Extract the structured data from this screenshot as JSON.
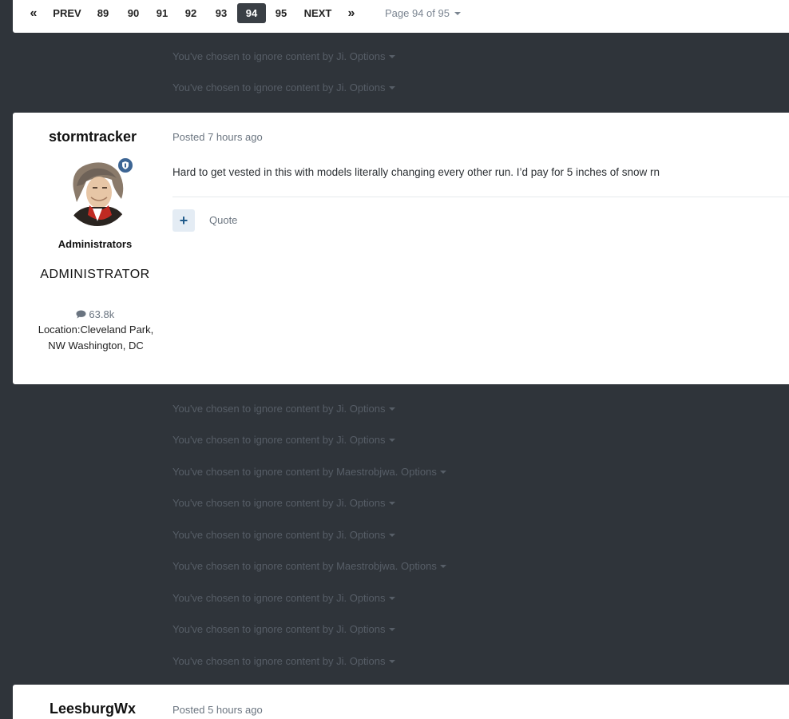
{
  "pagination": {
    "first": "«",
    "prev": "PREV",
    "pages": [
      "89",
      "90",
      "91",
      "92",
      "93",
      "94",
      "95"
    ],
    "active": "94",
    "next": "NEXT",
    "last": "»",
    "page_of": "Page 94 of 95"
  },
  "ignored_top": [
    "You've chosen to ignore content by Ji. Options",
    "You've chosen to ignore content by Ji. Options"
  ],
  "post1": {
    "author": "stormtracker",
    "group": "Administrators",
    "rank": "ADMINISTRATOR",
    "post_count": "63.8k",
    "location_label": "Location:",
    "location_value": "Cleveland Park, NW Washington, DC",
    "posted": "Posted 7 hours ago",
    "content": "Hard to get vested in this with models literally changing every other run. I’d pay for 5 inches of snow rn",
    "plus_label": "+",
    "quote_label": "Quote",
    "badge_color": "#3d6594"
  },
  "ignored_middle": [
    "You've chosen to ignore content by Ji. Options",
    "You've chosen to ignore content by Ji. Options",
    "You've chosen to ignore content by Maestrobjwa. Options",
    "You've chosen to ignore content by Ji. Options",
    "You've chosen to ignore content by Ji. Options",
    "You've chosen to ignore content by Maestrobjwa. Options",
    "You've chosen to ignore content by Ji. Options",
    "You've chosen to ignore content by Ji. Options",
    "You've chosen to ignore content by Ji. Options"
  ],
  "post2": {
    "author": "LeesburgWx",
    "posted": "Posted 5 hours ago"
  },
  "colors": {
    "page_bg": "#2f343a",
    "card_bg": "#ffffff",
    "active_page_bg": "#3a3f45",
    "ignored_text": "#575e67"
  }
}
